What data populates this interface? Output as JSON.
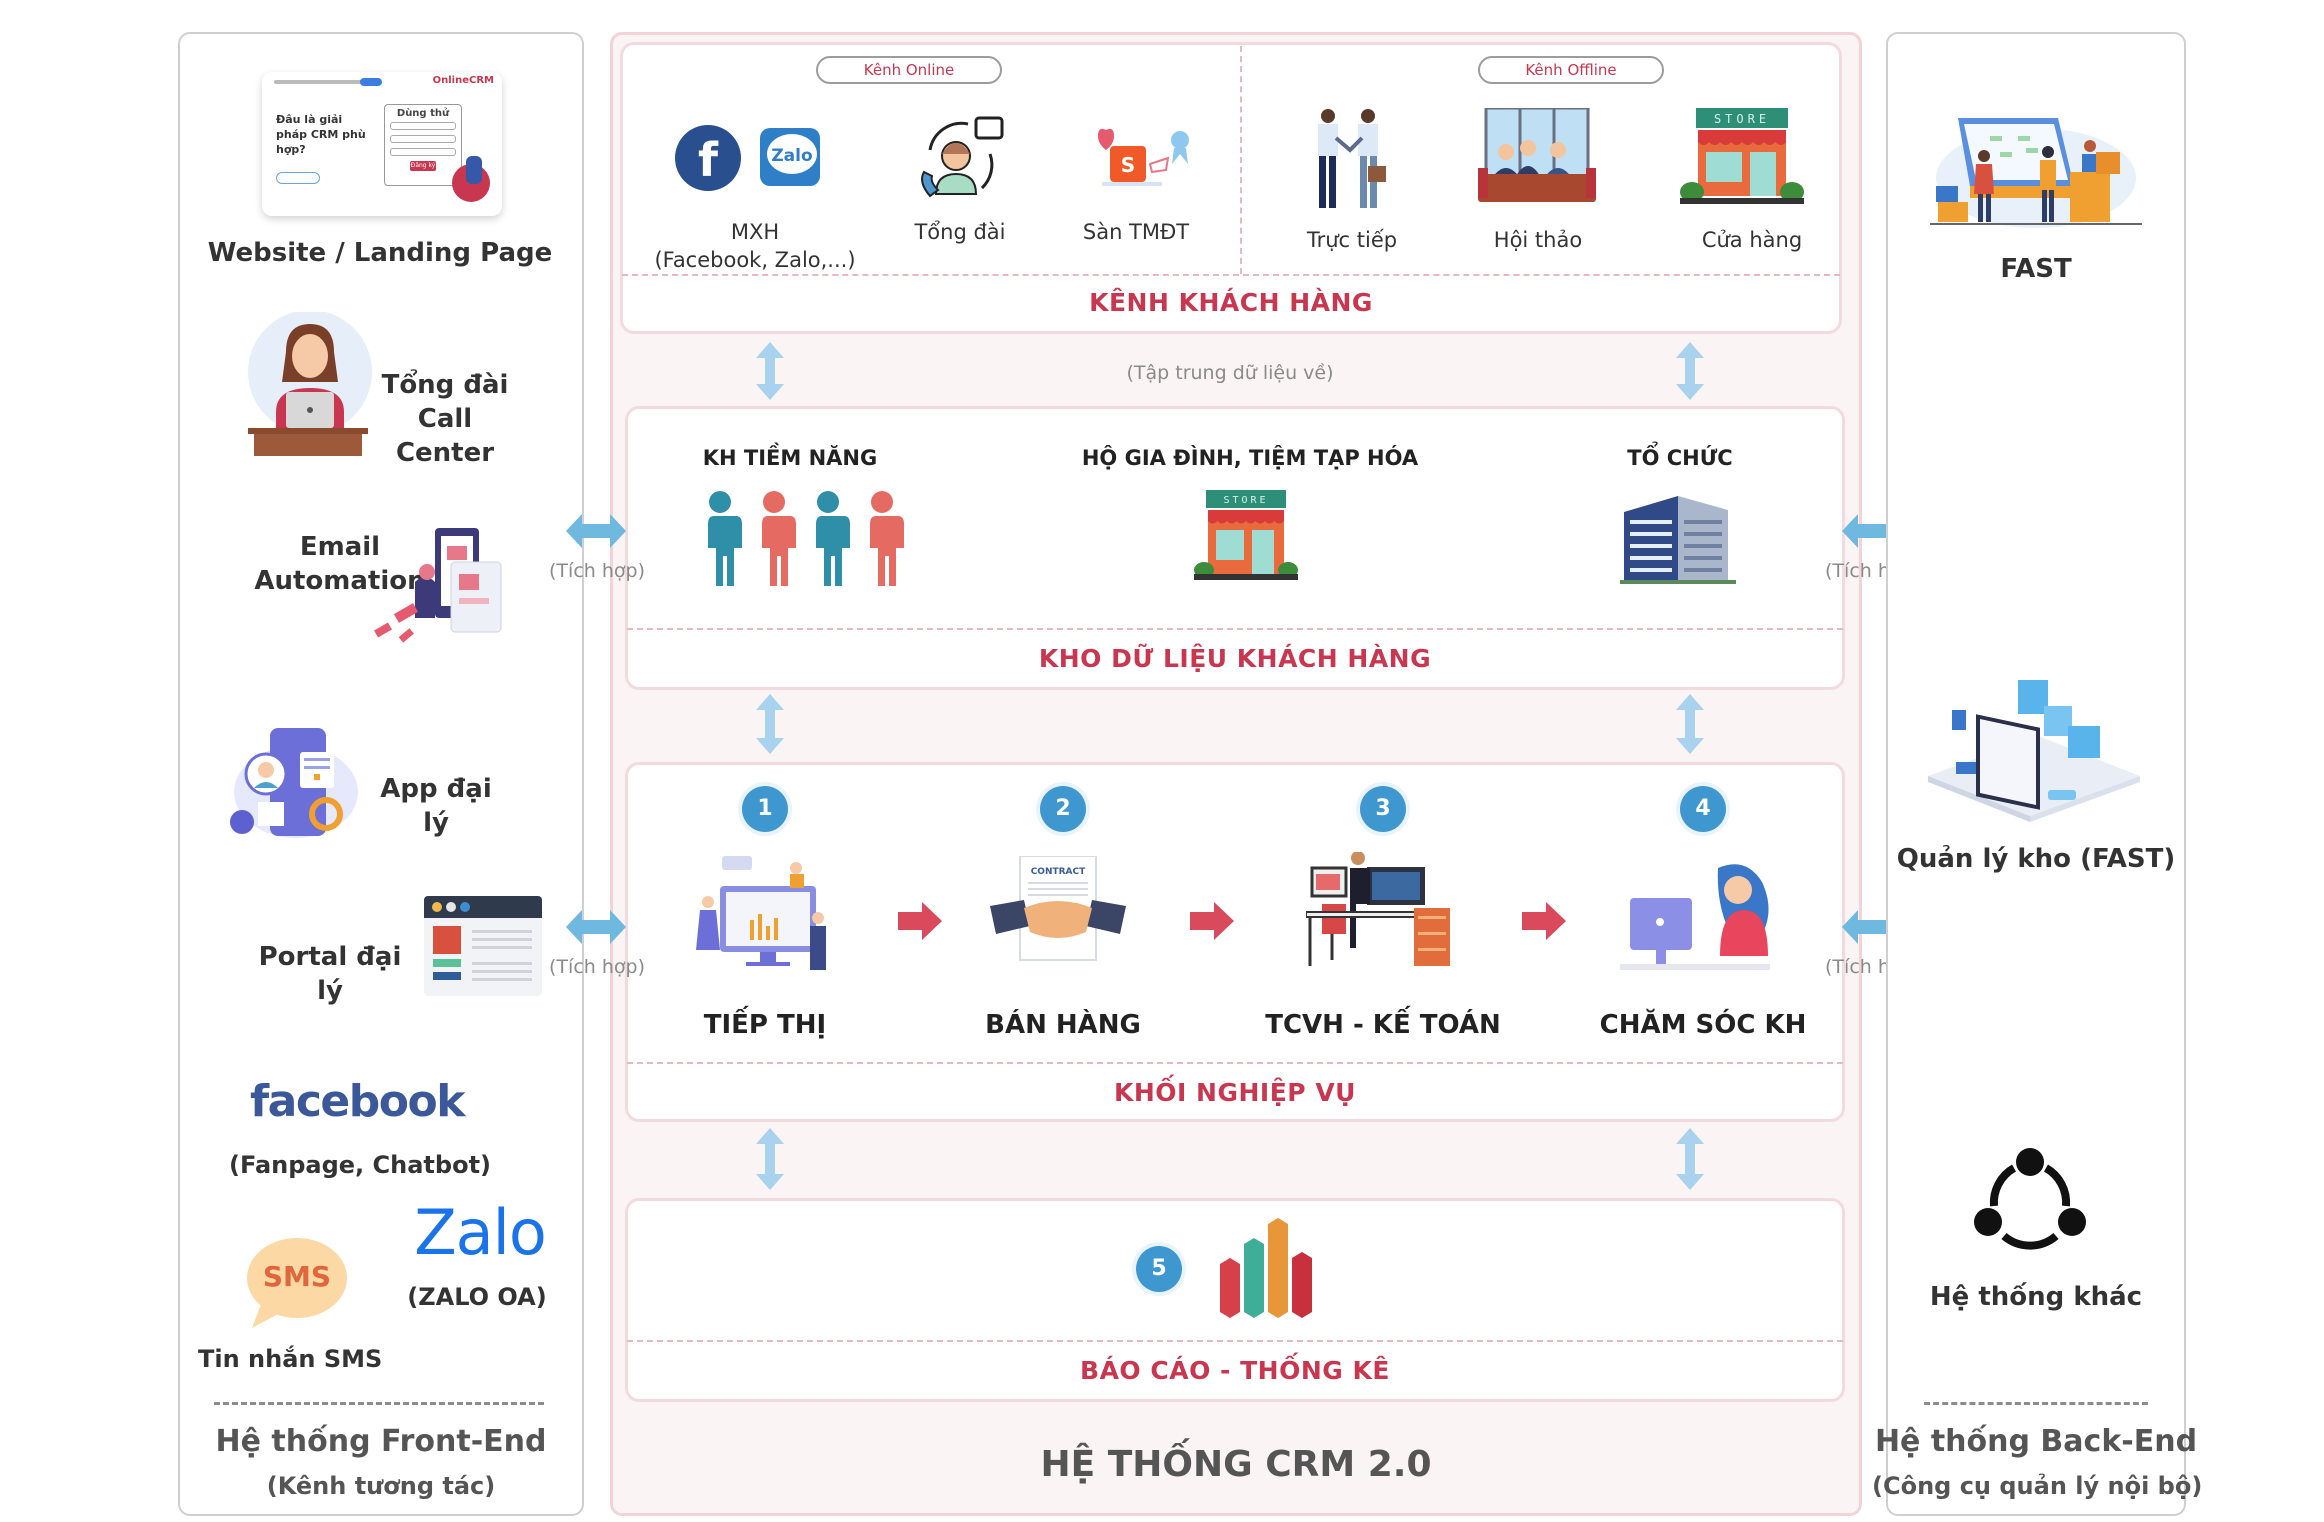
{
  "left_panel": {
    "items": [
      {
        "label": "Website / Landing Page",
        "mock_headline": "Đâu là giải pháp CRM phù hợp?",
        "mock_form_title": "Dùng thử",
        "mock_brand": "OnlineCRM",
        "mock_button": "Đăng ký"
      },
      {
        "label_line1": "Tổng đài",
        "label_line2": "Call Center"
      },
      {
        "label_line1": "Email",
        "label_line2": "Automation"
      },
      {
        "label": "App đại lý"
      },
      {
        "label": "Portal đại lý"
      },
      {
        "logo": "facebook",
        "label": "(Fanpage, Chatbot)"
      },
      {
        "logo": "Zalo",
        "label": "(ZALO OA)"
      },
      {
        "logo": "SMS",
        "label": "Tin nhắn SMS"
      }
    ],
    "footer_title": "Hệ thống Front-End",
    "footer_sub": "(Kênh tương tác)"
  },
  "center": {
    "channels": {
      "online_pill": "Kênh Online",
      "offline_pill": "Kênh Offline",
      "online": [
        {
          "icon": "facebook-zalo-icon",
          "label_line1": "MXH",
          "label_line2": "(Facebook, Zalo,...)"
        },
        {
          "icon": "call-center-icon",
          "label_line1": "Tổng đài"
        },
        {
          "icon": "ecommerce-icon",
          "label_line1": "Sàn TMĐT"
        }
      ],
      "offline": [
        {
          "icon": "handshake-icon",
          "label": "Trực tiếp"
        },
        {
          "icon": "meeting-icon",
          "label": "Hội thảo"
        },
        {
          "icon": "store-icon",
          "label": "Cửa hàng"
        }
      ],
      "title": "KÊNH KHÁCH HÀNG"
    },
    "collect_note": "(Tập trung dữ liệu về)",
    "data_store": {
      "categories": [
        "KH TIỀM NĂNG",
        "HỘ GIA ĐÌNH, TIỆM TẠP HÓA",
        "TỔ CHỨC"
      ],
      "store_sign": "STORE",
      "title": "KHO DỮ LIỆU KHÁCH HÀNG"
    },
    "business": {
      "steps": [
        {
          "num": "1",
          "label": "TIẾP THỊ"
        },
        {
          "num": "2",
          "label": "BÁN HÀNG",
          "doc_text": "CONTRACT"
        },
        {
          "num": "3",
          "label": "TCVH - KẾ TOÁN"
        },
        {
          "num": "4",
          "label": "CHĂM SÓC KH"
        }
      ],
      "title": "KHỐI NGHIỆP VỤ"
    },
    "report": {
      "num": "5",
      "title": "BÁO CÁO - THỐNG KÊ"
    },
    "system_title": "HỆ THỐNG CRM 2.0"
  },
  "integration_note": "(Tích hợp)",
  "right_panel": {
    "items": [
      {
        "label": "FAST"
      },
      {
        "label": "Quản lý kho (FAST)"
      },
      {
        "label": "Hệ thống khác"
      }
    ],
    "footer_title": "Hệ thống Back-End",
    "footer_sub": "(Công cụ quản lý nội bộ)"
  },
  "colors": {
    "accent_red": "#c8374f",
    "badge_blue": "#3f97d0",
    "arrow_blue": "#a8d2ee",
    "panel_pink": "#fbf4f5"
  }
}
